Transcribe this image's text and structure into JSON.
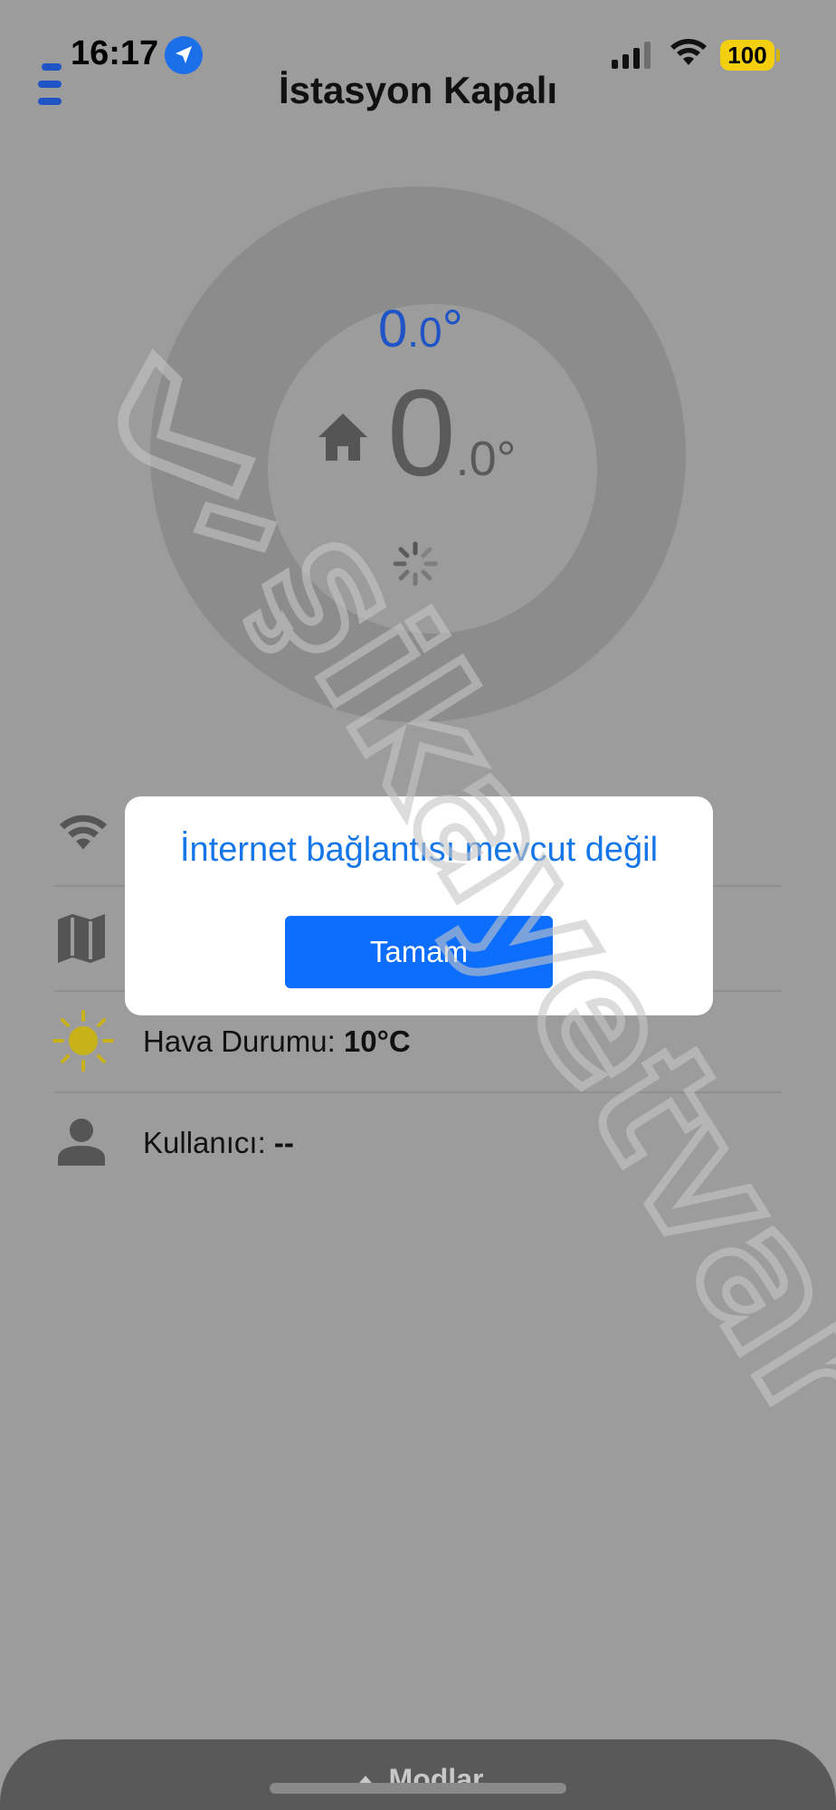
{
  "status_bar": {
    "time": "16:17",
    "battery": "100",
    "icons": [
      "location-arrow-icon",
      "cellular-signal-icon",
      "wifi-icon",
      "battery-icon"
    ]
  },
  "header": {
    "title": "İstasyon Kapalı",
    "menu_icon": "menu-icon"
  },
  "thermostat": {
    "target_temp": {
      "int": "0",
      "dec": ".0",
      "unit": "°"
    },
    "current_temp": {
      "int": "0",
      "dec": ".0",
      "unit": "°"
    },
    "home_icon": "home-icon",
    "loading_icon": "spinner-icon"
  },
  "info_rows": [
    {
      "icon": "wifi-icon"
    },
    {
      "icon": "map-icon"
    },
    {
      "icon": "sun-icon",
      "label": "Hava Durumu: ",
      "value": "10°C"
    },
    {
      "icon": "user-icon",
      "label": "Kullanıcı: ",
      "value": "--"
    }
  ],
  "dialog": {
    "message": "İnternet bağlantısı mevcut değil",
    "button": "Tamam"
  },
  "bottom_sheet": {
    "label": "Modlar"
  },
  "watermark_text": "şikayetvar",
  "colors": {
    "overlay": "#9c9c9c",
    "accent_blue": "#1576e8",
    "button_blue": "#0d6efd",
    "target_temp_blue": "#1e54c6",
    "sun_yellow": "#c8b21a",
    "battery_yellow": "#f3cf10"
  }
}
